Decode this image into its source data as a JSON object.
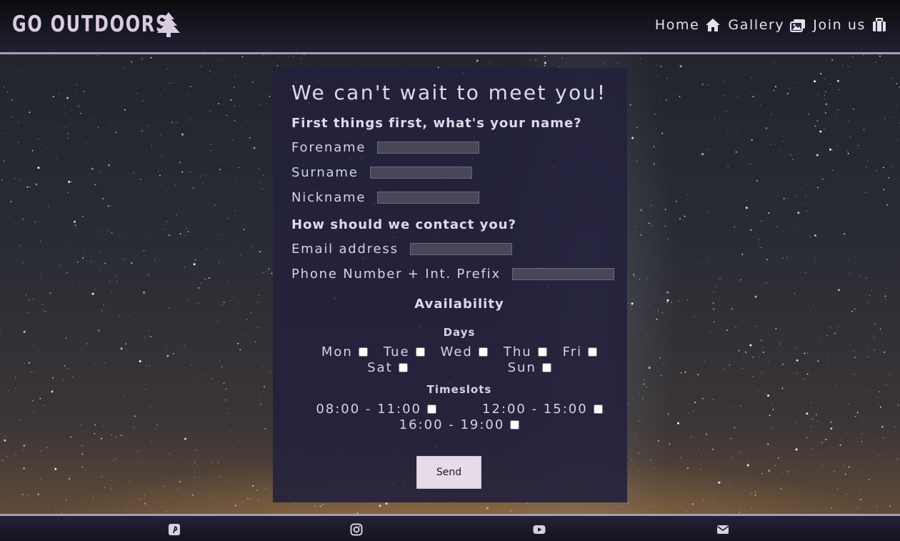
{
  "header": {
    "brand": "GO OUTDOORS",
    "brand_icon": "tree-icon",
    "nav": [
      {
        "label": "Home",
        "icon": "home-icon"
      },
      {
        "label": "Gallery",
        "icon": "images-icon"
      },
      {
        "label": "Join us",
        "icon": "suitcase-icon"
      }
    ]
  },
  "form": {
    "title": "We can't wait to meet you!",
    "name_section": "First things first, what's your name?",
    "forename_label": "Forename",
    "surname_label": "Surname",
    "nickname_label": "Nickname",
    "contact_section": "How should we contact you?",
    "email_label": "Email address",
    "phone_label": "Phone Number + Int. Prefix",
    "availability_title": "Availability",
    "days_title": "Days",
    "days": [
      "Mon",
      "Tue",
      "Wed",
      "Thu",
      "Fri",
      "Sat",
      "Sun"
    ],
    "timeslots_title": "Timeslots",
    "timeslots": [
      "08:00 - 11:00",
      "12:00 - 15:00",
      "16:00 - 19:00"
    ],
    "send_label": "Send"
  },
  "footer": {
    "icons": [
      "pinterest-icon",
      "instagram-icon",
      "youtube-icon",
      "envelope-icon"
    ]
  },
  "colors": {
    "header_bg": "#161621",
    "panel_bg": "#24213c",
    "text": "#d9d0e4",
    "button_bg": "#e6dbe8"
  }
}
